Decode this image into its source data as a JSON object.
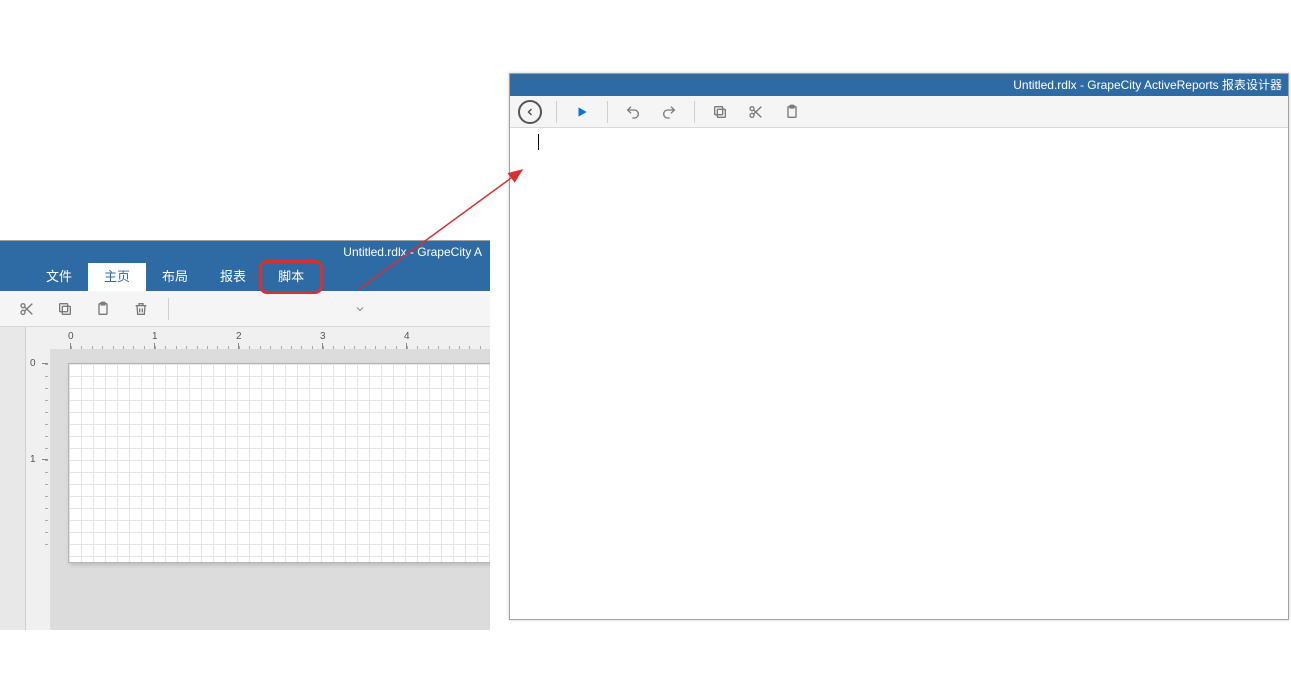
{
  "window1": {
    "title": "Untitled.rdlx - GrapeCity A",
    "tabs": {
      "file": {
        "label": "文件"
      },
      "home": {
        "label": "主页"
      },
      "layout": {
        "label": "布局"
      },
      "report": {
        "label": "报表"
      },
      "script": {
        "label": "脚本"
      }
    },
    "ruler_h": [
      "0",
      "1",
      "2",
      "3",
      "4"
    ],
    "ruler_v": [
      "0",
      "1"
    ]
  },
  "window2": {
    "title": "Untitled.rdlx - GrapeCity ActiveReports 报表设计器"
  }
}
